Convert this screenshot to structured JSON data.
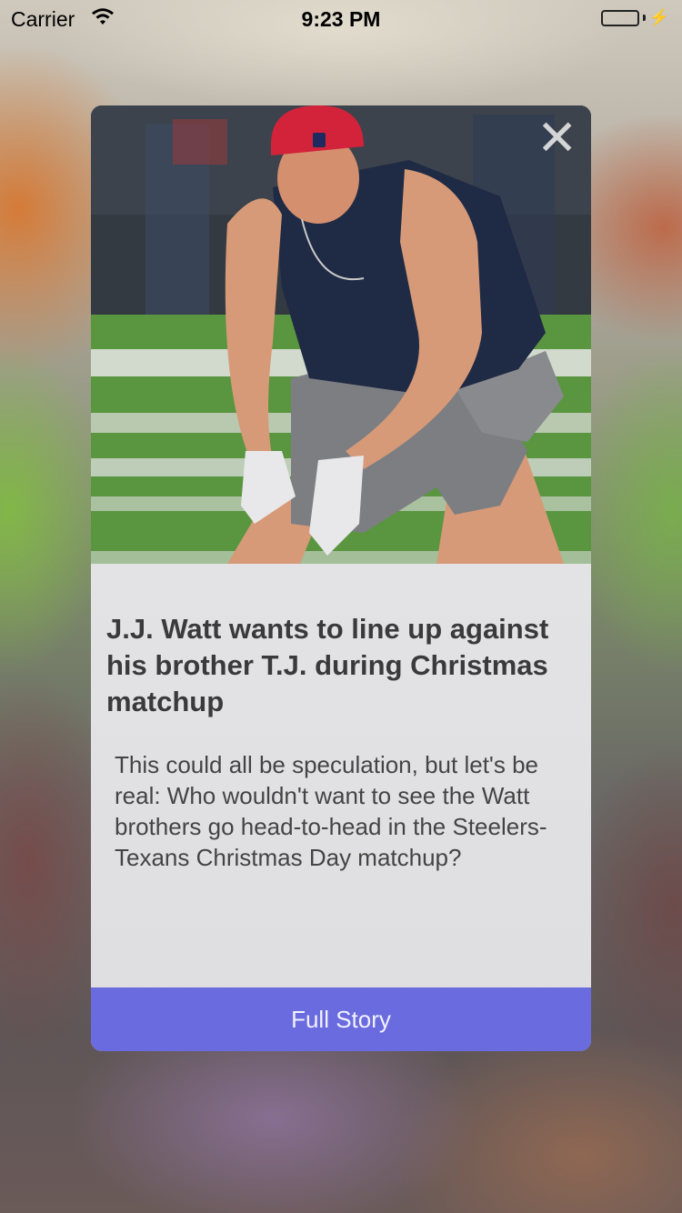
{
  "status_bar": {
    "carrier": "Carrier",
    "time": "9:23 PM"
  },
  "card": {
    "image_alt": "J.J. Watt in Texans practice gear on the field",
    "headline": "J.J. Watt wants to line up against his brother T.J. during Christmas matchup",
    "summary": "This could all be speculation, but let's be real: Who wouldn't want to see the Watt brothers go head-to-head in the Steelers-Texans Christmas Day matchup?",
    "cta_label": "Full Story",
    "close_glyph": "✕"
  },
  "colors": {
    "accent": "#6a6bde",
    "battery": "#4cd964"
  }
}
